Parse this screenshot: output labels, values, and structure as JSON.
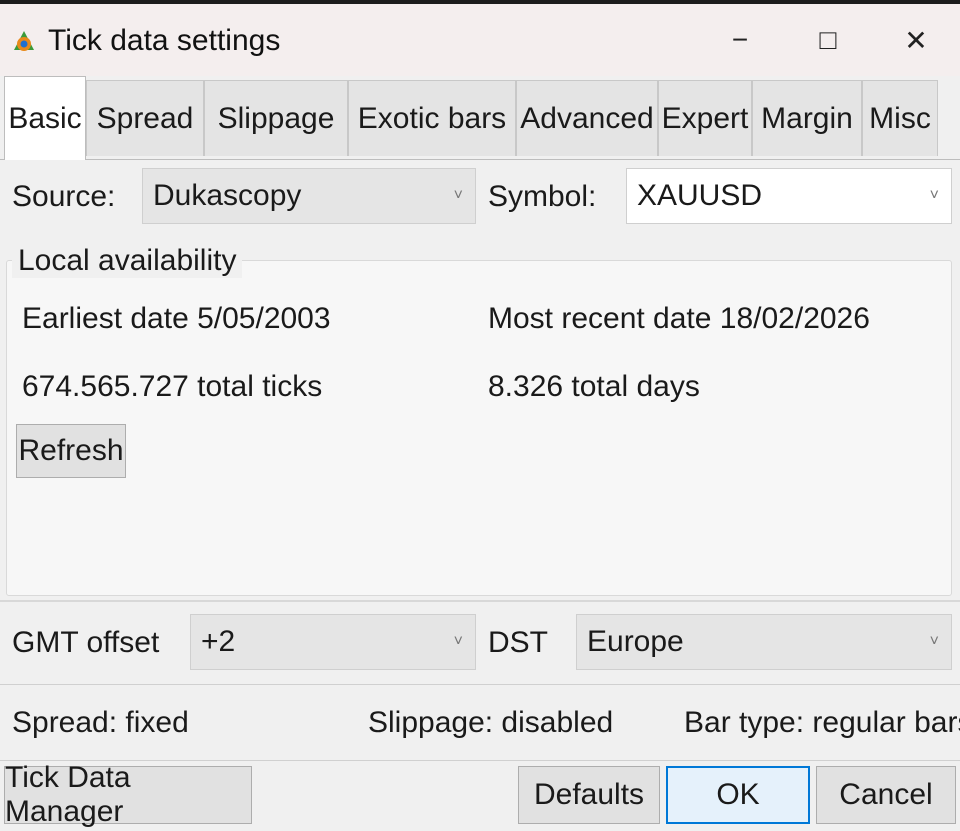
{
  "window": {
    "title": "Tick data settings",
    "minimize": "−",
    "maximize": "□",
    "close": "✕"
  },
  "tabs": [
    {
      "label": "Basic",
      "active": true
    },
    {
      "label": "Spread"
    },
    {
      "label": "Slippage"
    },
    {
      "label": "Exotic bars"
    },
    {
      "label": "Advanced"
    },
    {
      "label": "Expert"
    },
    {
      "label": "Margin"
    },
    {
      "label": "Misc"
    }
  ],
  "source": {
    "label": "Source:",
    "value": "Dukascopy"
  },
  "symbol": {
    "label": "Symbol:",
    "value": "XAUUSD"
  },
  "availability": {
    "legend": "Local availability",
    "earliest": "Earliest date 5/05/2003",
    "most_recent": "Most recent date 18/02/2026",
    "total_ticks": "674.565.727 total ticks",
    "total_days": "8.326 total days",
    "refresh": "Refresh"
  },
  "gmt": {
    "label": "GMT offset",
    "value": "+2"
  },
  "dst": {
    "label": "DST",
    "value": "Europe"
  },
  "status": {
    "spread": "Spread: fixed",
    "slippage": "Slippage: disabled",
    "bar_type": "Bar type: regular bars"
  },
  "buttons": {
    "tick_data_manager": "Tick Data Manager",
    "defaults": "Defaults",
    "ok": "OK",
    "cancel": "Cancel"
  },
  "chevron": "˅",
  "colors": {
    "accent": "#0078d7",
    "titlebar": "#f4eeee"
  }
}
